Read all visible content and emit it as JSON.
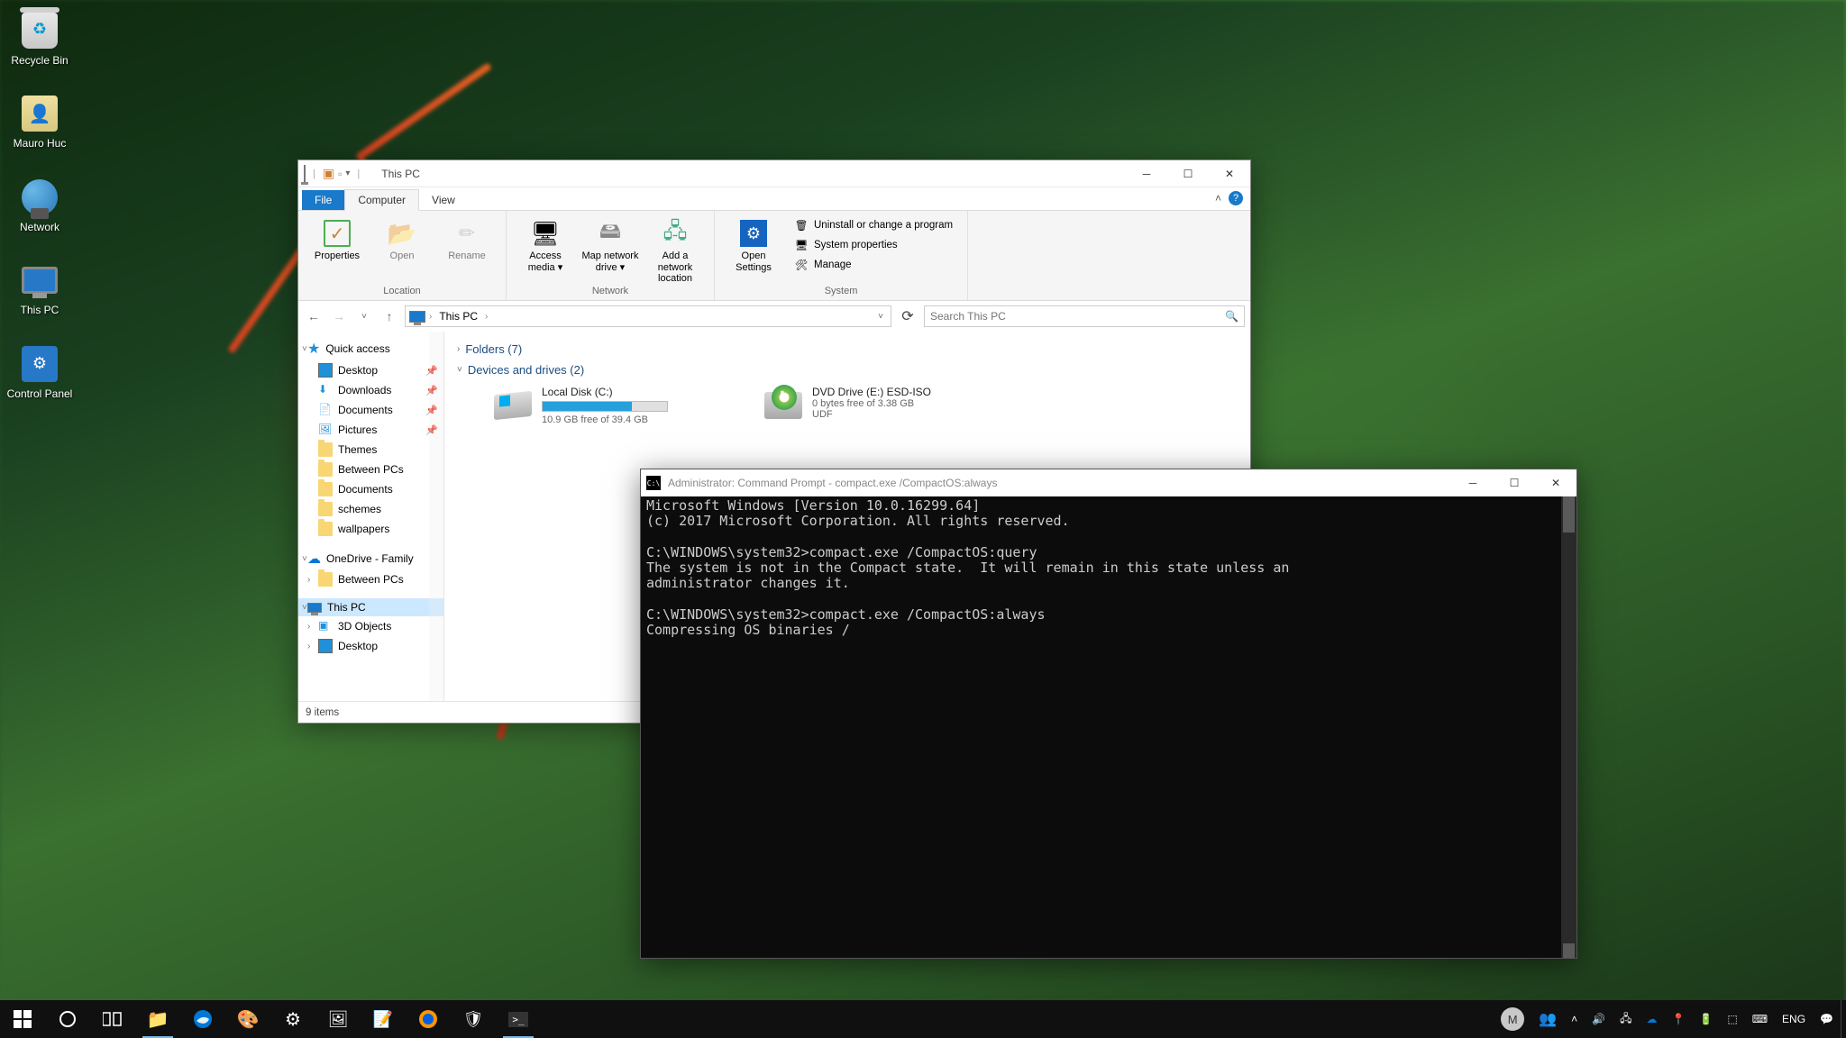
{
  "desktop": {
    "icons": [
      {
        "key": "recycle",
        "label": "Recycle Bin"
      },
      {
        "key": "user",
        "label": "Mauro Huc"
      },
      {
        "key": "network",
        "label": "Network"
      },
      {
        "key": "thispc",
        "label": "This PC"
      },
      {
        "key": "cpanel",
        "label": "Control Panel"
      }
    ]
  },
  "explorer": {
    "title": "This PC",
    "tabs": {
      "file": "File",
      "computer": "Computer",
      "view": "View"
    },
    "ribbon": {
      "location": {
        "label": "Location",
        "properties": "Properties",
        "open": "Open",
        "rename": "Rename"
      },
      "network": {
        "label": "Network",
        "access": "Access media ▾",
        "map": "Map network drive ▾",
        "add": "Add a network location"
      },
      "system": {
        "label": "System",
        "settings": "Open Settings",
        "uninstall": "Uninstall or change a program",
        "props": "System properties",
        "manage": "Manage"
      }
    },
    "breadcrumb": {
      "root": "This PC",
      "sep": "›"
    },
    "search_placeholder": "Search This PC",
    "tree": {
      "quick": "Quick access",
      "qa_items": [
        "Desktop",
        "Downloads",
        "Documents",
        "Pictures",
        "Themes",
        "Between PCs",
        "Documents",
        "schemes",
        "wallpapers"
      ],
      "onedrive": "OneDrive - Family",
      "od_items": [
        "Between PCs"
      ],
      "thispc": "This PC",
      "pc_items": [
        "3D Objects",
        "Desktop"
      ]
    },
    "groups": {
      "folders": "Folders (7)",
      "drives": "Devices and drives (2)"
    },
    "drive_c": {
      "name": "Local Disk (C:)",
      "free": "10.9 GB free of 39.4 GB",
      "fill_pct": 72
    },
    "drive_e": {
      "name": "DVD Drive (E:) ESD-ISO",
      "free": "0 bytes free of 3.38 GB",
      "fs": "UDF"
    },
    "status": "9 items"
  },
  "cmd": {
    "title": "Administrator: Command Prompt - compact.exe  /CompactOS:always",
    "lines": [
      "Microsoft Windows [Version 10.0.16299.64]",
      "(c) 2017 Microsoft Corporation. All rights reserved.",
      "",
      "C:\\WINDOWS\\system32>compact.exe /CompactOS:query",
      "The system is not in the Compact state.  It will remain in this state unless an",
      "administrator changes it.",
      "",
      "C:\\WINDOWS\\system32>compact.exe /CompactOS:always",
      "Compressing OS binaries /"
    ]
  },
  "taskbar": {
    "lang": "ENG",
    "user_letter": "M"
  }
}
